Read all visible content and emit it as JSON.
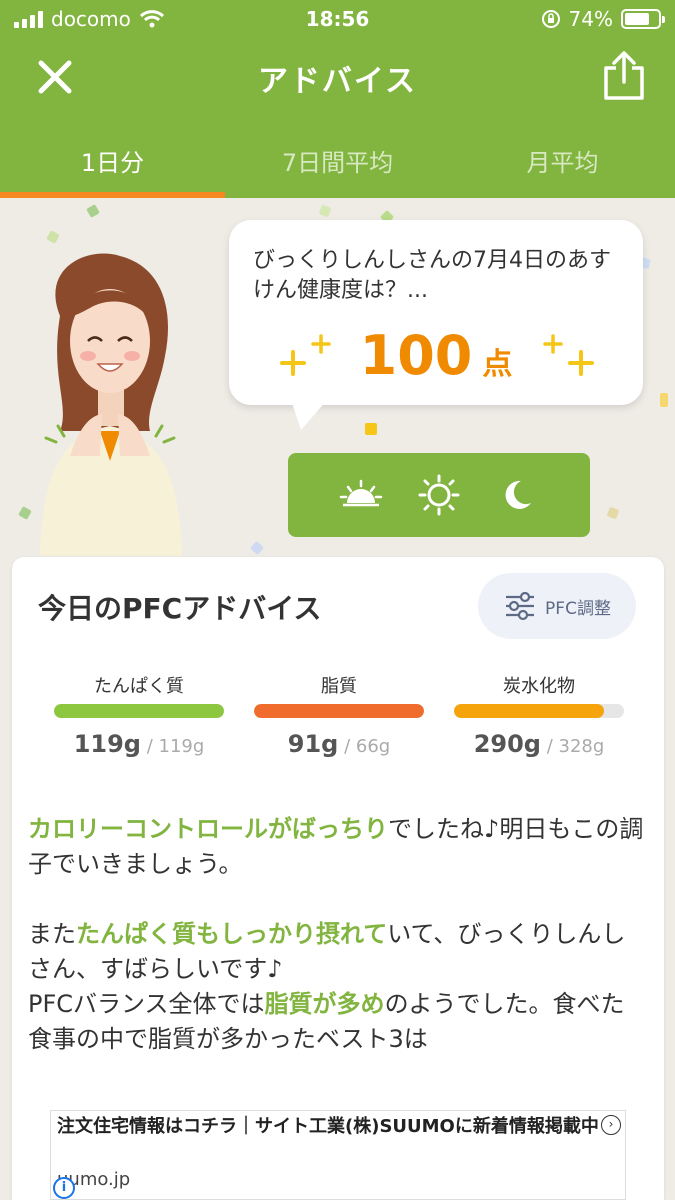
{
  "status_bar": {
    "carrier": "docomo",
    "time": "18:56",
    "battery": "74%",
    "battery_level": 0.74
  },
  "header": {
    "title": "アドバイス",
    "close_icon": "close-icon",
    "share_icon": "share-icon"
  },
  "tabs": [
    {
      "label": "1日分",
      "active": true
    },
    {
      "label": "7日間平均",
      "active": false
    },
    {
      "label": "月平均",
      "active": false
    }
  ],
  "hero": {
    "message": "びっくりしんしさんの7月4日のあすけん健康度は？...",
    "score": "100",
    "score_unit": "点",
    "meal_icons": [
      "sunrise-icon",
      "sun-icon",
      "moon-icon"
    ]
  },
  "card": {
    "title": "今日のPFCアドバイス",
    "pfc_button": "PFC調整",
    "nutrients": [
      {
        "label": "たんぱく質",
        "value": "119g",
        "target": " / 119g",
        "ratio": 1.0,
        "color": "#8dc63f"
      },
      {
        "label": "脂質",
        "value": "91g",
        "target": " / 66g",
        "ratio": 1.0,
        "color": "#ef6c2d"
      },
      {
        "label": "炭水化物",
        "value": "290g",
        "target": " / 328g",
        "ratio": 0.88,
        "color": "#f5a40b"
      }
    ],
    "advice": {
      "p1_hl": "カロリーコントロールがばっちり",
      "p1_rest": "でしたね♪明日もこの調子でいきましょう。",
      "p2_pre": "また",
      "p2_hl": "たんぱく質もしっかり摂れて",
      "p2_rest": "いて、びっくりしんしさん、すばらしいです♪",
      "p3_pre": "PFCバランス全体では",
      "p3_hl": "脂質が多め",
      "p3_rest": "のようでした。食べた食事の中で脂質が多かったベスト3は"
    }
  },
  "ad": {
    "text": "注文住宅情報はコチラ｜サイト工業(株)SUUMOに新着情報掲載中",
    "url": "uumo.jp",
    "info": "i",
    "arrow": "›"
  },
  "colors": {
    "brand_green": "#82b440",
    "tab_indicator": "#f5891f",
    "score": "#f08a00"
  }
}
